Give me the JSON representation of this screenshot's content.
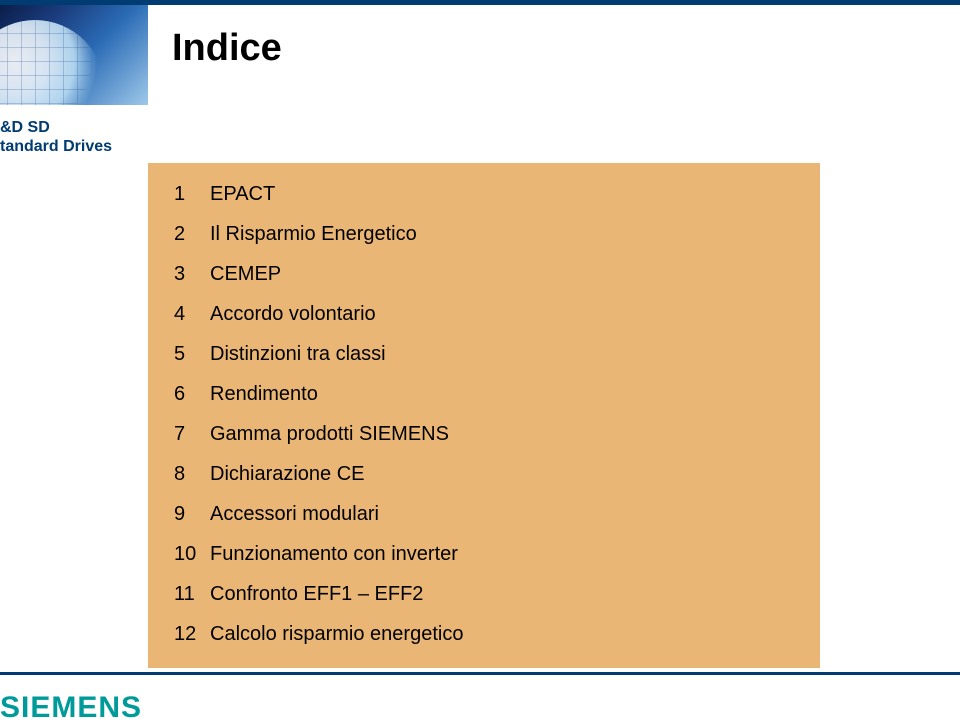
{
  "page": {
    "title": "Indice"
  },
  "brand": {
    "dept_line1": "&D SD",
    "dept_line2": "tandard Drives",
    "logo_text": "SIEMENS"
  },
  "toc": [
    {
      "num": "1",
      "label": "EPACT"
    },
    {
      "num": "2",
      "label": "Il Risparmio Energetico"
    },
    {
      "num": "3",
      "label": "CEMEP"
    },
    {
      "num": "4",
      "label": "Accordo volontario"
    },
    {
      "num": "5",
      "label": "Distinzioni tra classi"
    },
    {
      "num": "6",
      "label": "Rendimento"
    },
    {
      "num": "7",
      "label": "Gamma prodotti SIEMENS"
    },
    {
      "num": "8",
      "label": "Dichiarazione CE"
    },
    {
      "num": "9",
      "label": "Accessori modulari"
    },
    {
      "num": "10",
      "label": " Funzionamento con inverter"
    },
    {
      "num": "11",
      "label": "Confronto EFF1 – EFF2"
    },
    {
      "num": "12",
      "label": "Calcolo risparmio energetico"
    }
  ]
}
